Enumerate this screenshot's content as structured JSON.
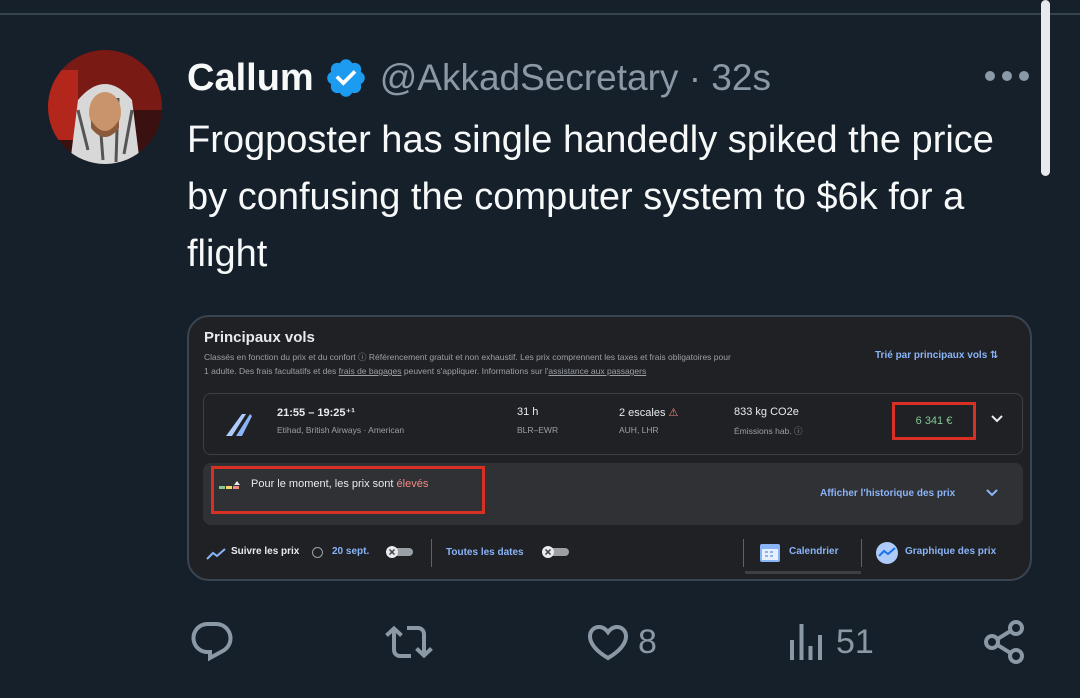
{
  "tweet": {
    "author_name": "Callum",
    "handle_time": "@AkkadSecretary · 32s",
    "text": "Frogposter has single handedly spiked the price by confusing the computer system to $6k for a flight"
  },
  "embedded_screenshot": {
    "title": "Principaux vols",
    "description_1": "Classés en fonction du prix et du confort ⓘ   Référencement gratuit et non exhaustif. Les prix comprennent les taxes et frais obligatoires pour",
    "description_2a": "1 adulte. Des frais facultatifs et des ",
    "description_2_link": "frais de bagages",
    "description_2b": " peuvent s'appliquer. Informations sur l'",
    "description_2_link2": "assistance aux passagers",
    "sort_label": "Trié par principaux vols ⇅",
    "flight": {
      "times": "21:55 – 19:25⁺¹",
      "airlines": "Etihad, British Airways · American",
      "duration": "31 h",
      "route": "BLR–EWR",
      "stops": "2 escales",
      "stops_warning": "⚠",
      "via": "AUH, LHR",
      "co2": "833 kg CO2e",
      "emissions": "Émissions hab. ⓘ",
      "price": "6 341 €"
    },
    "insight": {
      "text_before": "Pour le moment, les prix sont ",
      "text_highlight": "élevés",
      "history_link": "Afficher l'historique des prix"
    },
    "bottom": {
      "track_label": "Suivre les prix",
      "track_date": "20 sept.",
      "all_dates": "Toutes les dates",
      "calendar": "Calendrier",
      "graph": "Graphique des prix"
    }
  },
  "actions": {
    "likes": "8",
    "views": "51"
  },
  "colors": {
    "background": "#15202b",
    "verified_blue": "#1d9bf0",
    "secondary_text": "#8b98a5",
    "highlight_red": "#d93025"
  }
}
